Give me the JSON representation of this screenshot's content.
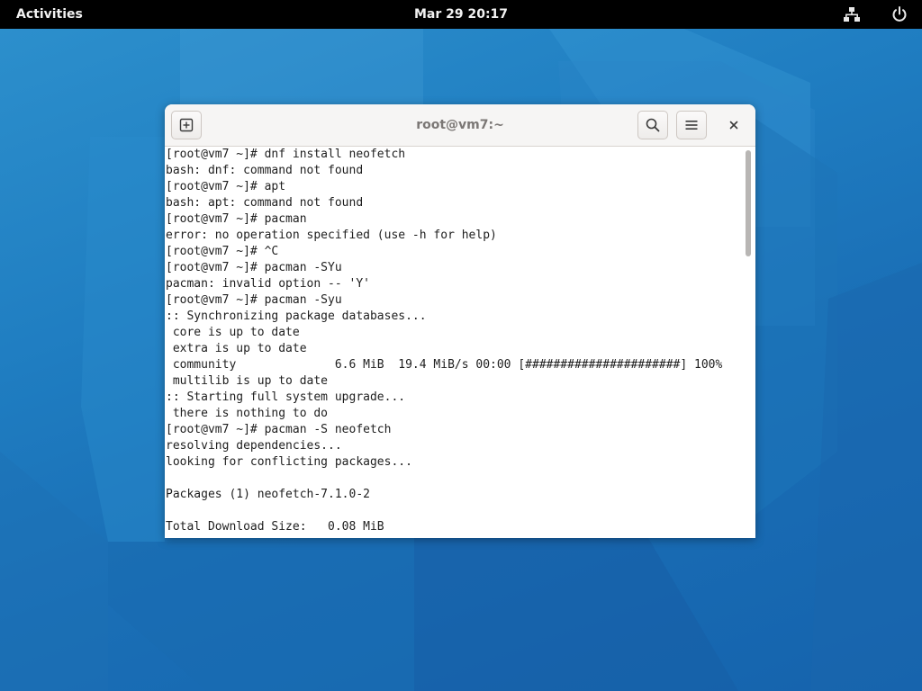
{
  "topbar": {
    "activities_label": "Activities",
    "clock": "Mar 29  20:17",
    "network_icon": "network-icon",
    "power_icon": "power-icon"
  },
  "window": {
    "title": "root@vm7:~",
    "new_tab_icon": "new-tab-icon",
    "search_icon": "search-icon",
    "menu_icon": "hamburger-menu-icon",
    "close_icon": "close-icon"
  },
  "terminal": {
    "lines": [
      "[root@vm7 ~]# dnf install neofetch",
      "bash: dnf: command not found",
      "[root@vm7 ~]# apt",
      "bash: apt: command not found",
      "[root@vm7 ~]# pacman",
      "error: no operation specified (use -h for help)",
      "[root@vm7 ~]# ^C",
      "[root@vm7 ~]# pacman -SYu",
      "pacman: invalid option -- 'Y'",
      "[root@vm7 ~]# pacman -Syu",
      ":: Synchronizing package databases...",
      " core is up to date",
      " extra is up to date",
      " community              6.6 MiB  19.4 MiB/s 00:00 [######################] 100%",
      " multilib is up to date",
      ":: Starting full system upgrade...",
      " there is nothing to do",
      "[root@vm7 ~]# pacman -S neofetch",
      "resolving dependencies...",
      "looking for conflicting packages...",
      "",
      "Packages (1) neofetch-7.1.0-2",
      "",
      "Total Download Size:   0.08 MiB"
    ],
    "scroll_position": 0.0
  },
  "colors": {
    "topbar": "#000000",
    "wallpaper": "#1f7dc1",
    "headerbar": "#f6f5f4",
    "terminal_bg": "#ffffff",
    "terminal_fg": "#1e1e1e"
  }
}
